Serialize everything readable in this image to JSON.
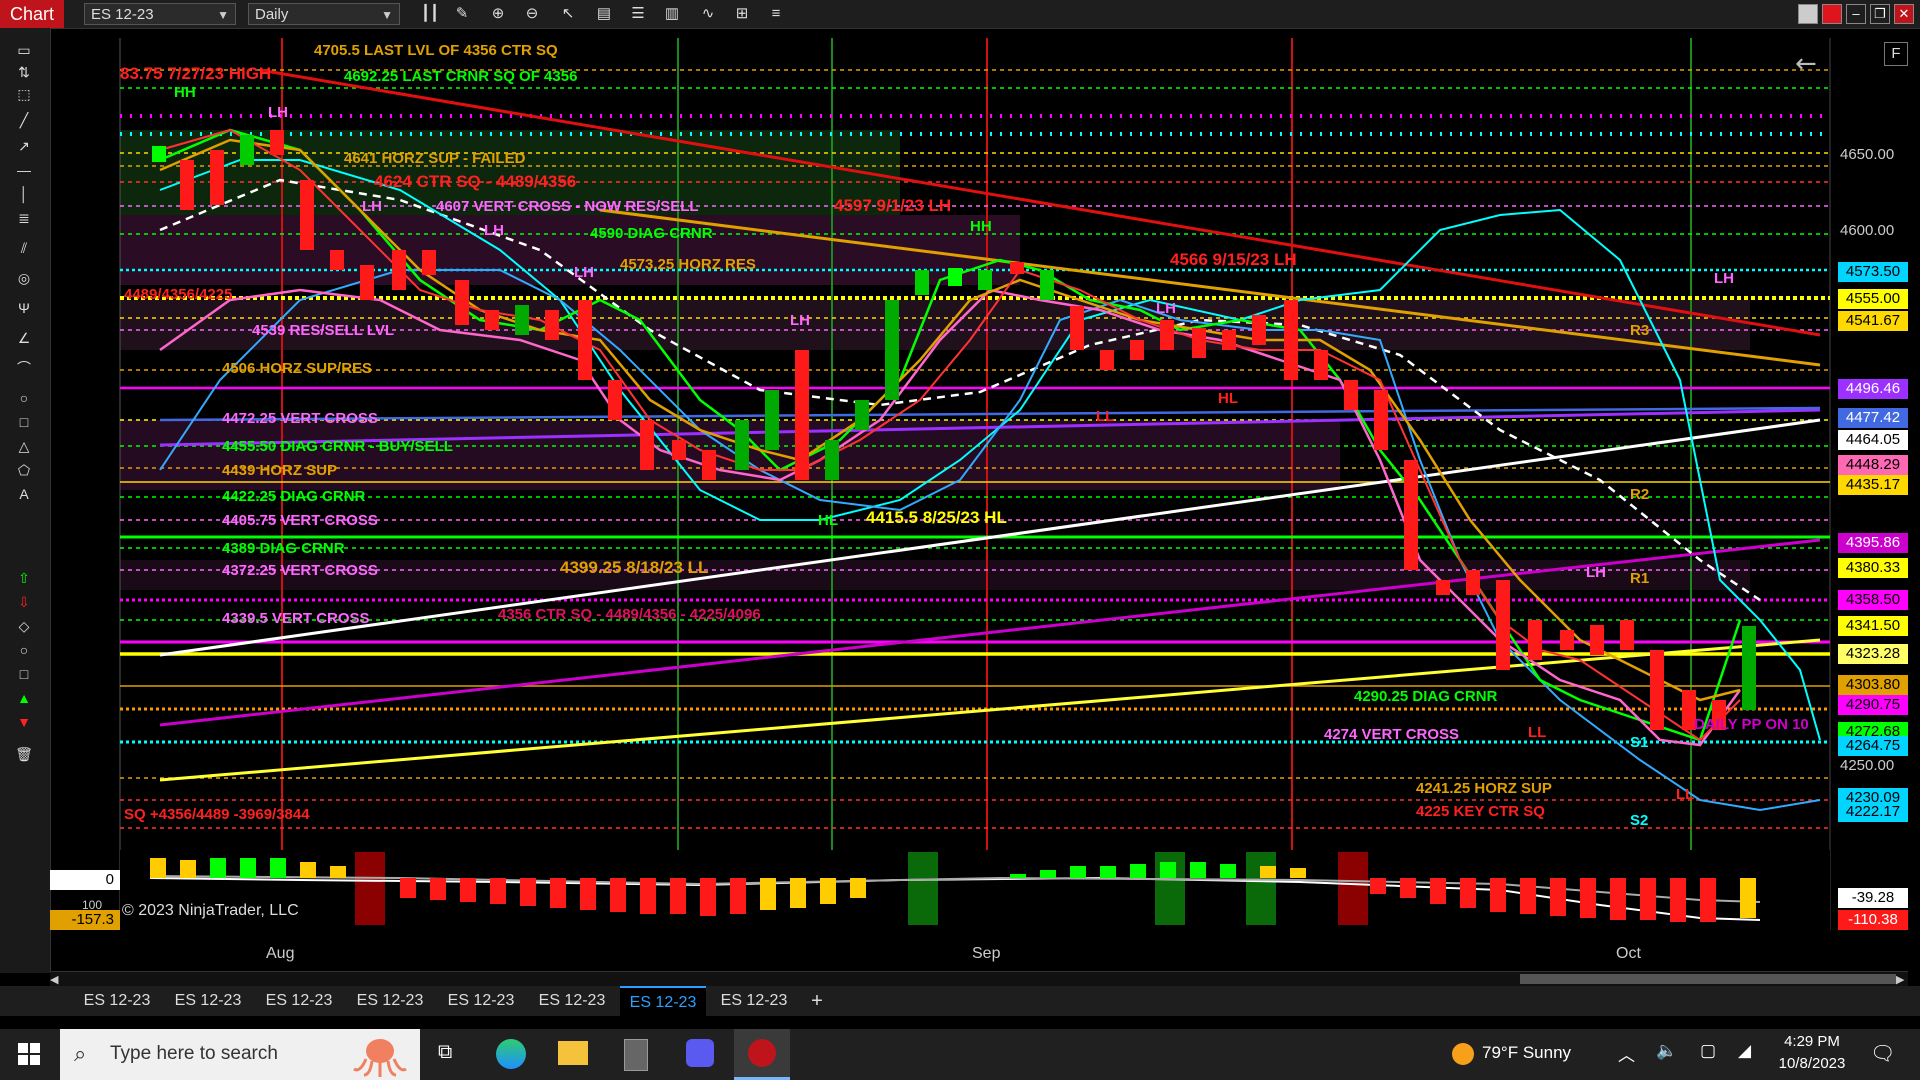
{
  "window": {
    "title": "Chart",
    "instrument": "ES 12-23",
    "interval": "Daily",
    "f_button": "F"
  },
  "price_axis": {
    "plain": [
      "4650.00",
      "4600.00",
      "4250.00"
    ],
    "tags": [
      {
        "text": "4573.50",
        "bg": "#00d4ff"
      },
      {
        "text": "4555.00",
        "bg": "#ffff00"
      },
      {
        "text": "4541.67",
        "bg": "#ffd800"
      },
      {
        "text": "4496.46",
        "bg": "#9b30ff"
      },
      {
        "text": "4477.42",
        "bg": "#4169e1"
      },
      {
        "text": "4464.05",
        "bg": "#ffffff"
      },
      {
        "text": "4448.29",
        "bg": "#ff69b4"
      },
      {
        "text": "4435.17",
        "bg": "#ffd800"
      },
      {
        "text": "4395.86",
        "bg": "#cc00cc"
      },
      {
        "text": "4380.33",
        "bg": "#ffff00"
      },
      {
        "text": "4358.50",
        "bg": "#ff00ff"
      },
      {
        "text": "4341.50",
        "bg": "#ffff00"
      },
      {
        "text": "4323.28",
        "bg": "#ffff66"
      },
      {
        "text": "4303.80",
        "bg": "#e0a000"
      },
      {
        "text": "4290.75",
        "bg": "#ff00ff"
      },
      {
        "text": "4272.68",
        "bg": "#00ff00"
      },
      {
        "text": "4264.75",
        "bg": "#00d4ff"
      },
      {
        "text": "4230.09",
        "bg": "#00d4ff"
      },
      {
        "text": "4222.17",
        "bg": "#00d4ff"
      }
    ]
  },
  "annotations": {
    "a1": "4705.5 LAST LVL OF 4356 CTR SQ",
    "a2": "83.75 7/27/23 HIGH",
    "a3": "4692.25 LAST CRNR SQ OF 4356",
    "a4": "4641 HORZ SUP - FAILED",
    "a5": "4624 CTR SQ - 4489/4356",
    "a6": "4607 VERT CROSS - NOW RES/SELL",
    "a7": "4597 9/1/23 LH",
    "a8": "4590 DIAG CRNR",
    "a9": "4566 9/15/23 LH",
    "a10": "4573.25 HORZ RES",
    "a11": "4489/4356/4225",
    "a12": "4539 RES/SELL LVL",
    "a13": "4506 HORZ SUP/RES",
    "a14": "4472.25 VERT CROSS",
    "a15": "4455.50 DIAG CRNR - BUY/SELL",
    "a16": "4439 HORZ SUP",
    "a17": "4422.25 DIAG CRNR",
    "a18": "4405.75 VERT CROSS",
    "a19": "4415.5 8/25/23 HL",
    "a20": "4389 DIAG CRNR",
    "a21": "4372.25 VERT CROSS",
    "a22": "4399.25 8/18/23 LL",
    "a23": "4356 CTR SQ - 4489/4356 - 4225/4096",
    "a24": "4339.5 VERT CROSS",
    "a25": "4290.25 DIAG CRNR",
    "a26": "4274 VERT CROSS",
    "a27": "DAILY PP ON 10",
    "a28": "4241.25 HORZ SUP",
    "a29": "4225 KEY CTR SQ",
    "a30": "SQ +4356/4489 -3969/3844"
  },
  "swing_labels": {
    "hh1": "HH",
    "lh1": "LH",
    "lh2": "LH",
    "lh3": "LH",
    "lh4": "LH",
    "lh5": "LH",
    "hh2": "HH",
    "hl1": "HL",
    "hl2": "HL",
    "ll1": "LL",
    "ll2": "LL",
    "lh6": "LH",
    "lh7": "LH",
    "r3": "R3",
    "r2": "R2",
    "r1": "R1",
    "s1": "S1",
    "s2": "S2",
    "ll3": "LL",
    "lh8": "LH"
  },
  "indicator": {
    "box_top": "0",
    "box_bottom": "-157.3",
    "partial_label": "100",
    "right_top": "-39.28",
    "right_bottom": "-110.38"
  },
  "copyright": "© 2023 NinjaTrader, LLC",
  "dates": [
    "Aug",
    "Sep",
    "Oct"
  ],
  "tabs": [
    "ES 12-23",
    "ES 12-23",
    "ES 12-23",
    "ES 12-23",
    "ES 12-23",
    "ES 12-23",
    "ES 12-23",
    "ES 12-23"
  ],
  "active_tab": 6,
  "add_tab": "+",
  "taskbar": {
    "search_placeholder": "Type here to search",
    "weather": "79°F  Sunny",
    "time": "4:29 PM",
    "date": "10/8/2023"
  }
}
